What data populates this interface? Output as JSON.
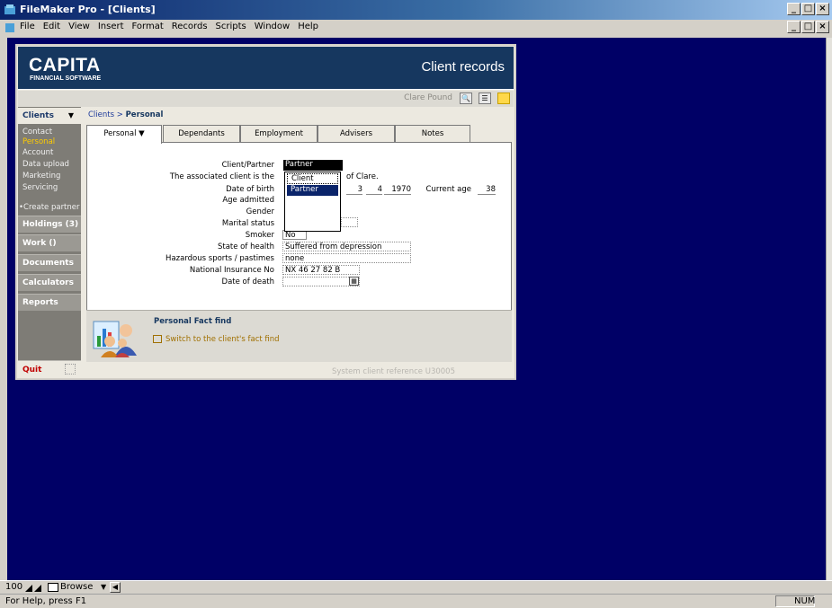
{
  "window": {
    "title": "FileMaker Pro - [Clients]",
    "menu": [
      "File",
      "Edit",
      "View",
      "Insert",
      "Format",
      "Records",
      "Scripts",
      "Window",
      "Help"
    ]
  },
  "header": {
    "logo": "CAPITA",
    "logo_sub": "FINANCIAL SOFTWARE",
    "heading": "Client records",
    "user": "Clare Pound"
  },
  "sidebar": {
    "section": "Clients",
    "subnav": [
      "Contact",
      "Personal",
      "Account",
      "Data upload",
      "Marketing",
      "Servicing"
    ],
    "active": "Personal",
    "create_partner": "•Create partner",
    "buttons": [
      "Holdings (3)",
      "Work ()",
      "Documents",
      "Calculators",
      "Reports"
    ],
    "quit": "Quit"
  },
  "breadcrumb": {
    "parent": "Clients",
    "separator": " > ",
    "current": "Personal"
  },
  "tabs": [
    "Personal  ▼",
    "Dependants",
    "Employment",
    "Advisers",
    "Notes"
  ],
  "form": {
    "labels": {
      "client_partner": "Client/Partner",
      "associated": "The associated client is the",
      "dob": "Date of birth",
      "age_admitted": "Age admitted",
      "gender": "Gender",
      "marital": "Marital status",
      "smoker": "Smoker",
      "health": "State of health",
      "hazardous": "Hazardous sports / pastimes",
      "ni": "National Insurance No",
      "dod": "Date of death",
      "current_age": "Current age"
    },
    "client_partner_value": "Partner",
    "associated_suffix": "of Clare.",
    "dob_day": "3",
    "dob_month": "4",
    "dob_year": "1970",
    "current_age_value": "38",
    "smoker_value": "No",
    "health_value": "Suffered from depression",
    "hazardous_value": "none",
    "ni_value": "NX 46 27 82 B",
    "dod_value": "",
    "dropdown_options": [
      "Client",
      "Partner"
    ],
    "dropdown_selected": "Partner"
  },
  "factfind": {
    "title": "Personal Fact find",
    "link": "Switch to the client's fact find"
  },
  "system_ref": "System client reference  U30005",
  "bottombar": {
    "zoom": "100",
    "mode": "Browse"
  },
  "status": {
    "help": "For Help, press F1",
    "num": "NUM"
  }
}
